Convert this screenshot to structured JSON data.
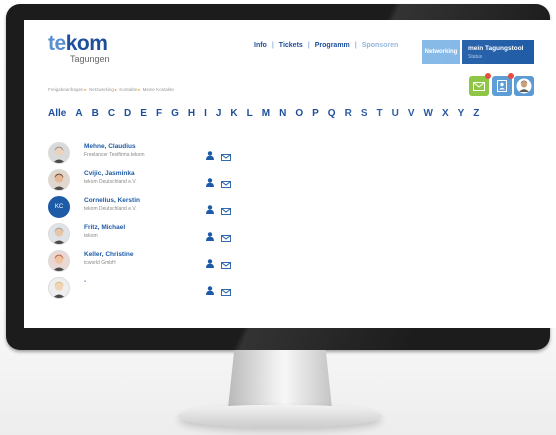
{
  "header": {
    "logo_main": "te",
    "logo_main_accent": "kom",
    "logo_sub": "Tagungen",
    "nav": [
      {
        "label": "Info"
      },
      {
        "label": "Tickets"
      },
      {
        "label": "Programm"
      },
      {
        "label": "Sponsoren"
      }
    ],
    "networking_label": "Networking",
    "tagungstool_label": "mein Tagungstool",
    "tagungstool_sub": "Status"
  },
  "breadcrumb": [
    "Freigabeanfragen",
    "Netzwerking",
    "Kontakte",
    "Meine Kontakte"
  ],
  "alphabet": [
    "Alle",
    "A",
    "B",
    "C",
    "D",
    "E",
    "F",
    "G",
    "H",
    "I",
    "J",
    "K",
    "L",
    "M",
    "N",
    "O",
    "P",
    "Q",
    "R",
    "S",
    "T",
    "U",
    "V",
    "W",
    "X",
    "Y",
    "Z"
  ],
  "contacts": [
    {
      "name": "Mehne, Claudius",
      "org": "Freelancer Testfirma tekom",
      "avatar": "photo"
    },
    {
      "name": "Cvijic, Jasminka",
      "org": "tekom Deutschland e.V.",
      "avatar": "photo"
    },
    {
      "name": "Cornelius, Kerstin",
      "org": "tekom Deutschland e.V.",
      "avatar": "initials",
      "initials": "KC"
    },
    {
      "name": "Fritz, Michael",
      "org": "tekom",
      "avatar": "photo"
    },
    {
      "name": "Keller, Christine",
      "org": "tcworld GmbH",
      "avatar": "photo"
    },
    {
      "name": "-",
      "org": "",
      "avatar": "photo"
    }
  ],
  "colors": {
    "brand_dark": "#1e4f9c",
    "brand_light": "#5a90cf",
    "accent_green": "#8cc43f",
    "notification": "#e34b3b"
  },
  "icons": {
    "mail": "envelope-icon",
    "person": "person-icon",
    "contact_card": "contact-card-icon"
  }
}
